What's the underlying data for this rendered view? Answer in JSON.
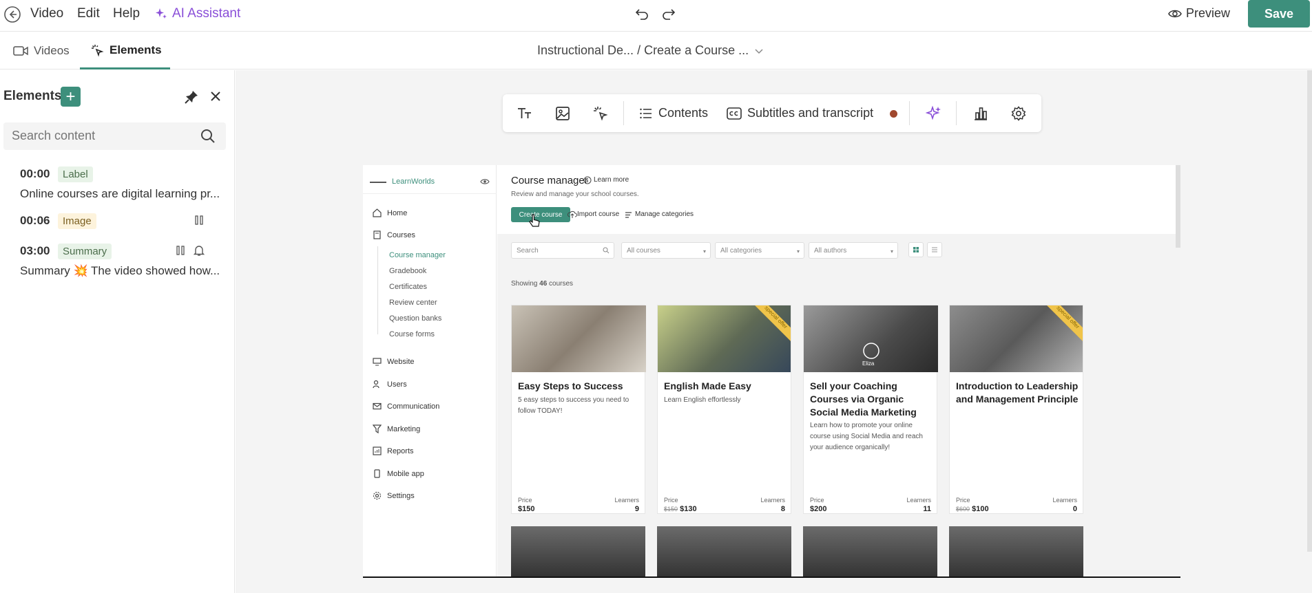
{
  "topbar": {
    "menu": [
      "Video",
      "Edit",
      "Help"
    ],
    "ai_assistant": "AI Assistant",
    "preview": "Preview",
    "save": "Save"
  },
  "tabs": [
    "Videos",
    "Elements"
  ],
  "breadcrumb": "Instructional De...  / Create a Course ...",
  "panel": {
    "title": "Elements",
    "search_placeholder": "Search content",
    "elements": [
      {
        "time": "00:00",
        "type": "Label",
        "text": "Online courses are digital learning pr..."
      },
      {
        "time": "00:06",
        "type": "Image",
        "text": ""
      },
      {
        "time": "03:00",
        "type": "Summary",
        "text": "Summary 💥 The video showed how..."
      }
    ]
  },
  "toolbar": {
    "contents": "Contents",
    "subtitles": "Subtitles and transcript",
    "status_color": "#a0482e"
  },
  "video": {
    "brand": "LearnWorlds",
    "nav": [
      "Home",
      "Courses",
      "Website",
      "Users",
      "Communication",
      "Marketing",
      "Reports",
      "Mobile app",
      "Settings"
    ],
    "courses_sub": [
      "Course manager",
      "Gradebook",
      "Certificates",
      "Review center",
      "Question banks",
      "Course forms"
    ],
    "header_title": "Course manager",
    "learn_more": "Learn more",
    "header_sub": "Review and manage your school courses.",
    "create_course": "Create course",
    "import_course": "Import course",
    "manage_categories": "Manage categories",
    "filters": {
      "search": "Search",
      "all_courses": "All courses",
      "all_categories": "All categories",
      "all_authors": "All authors"
    },
    "showing": "Showing",
    "count": "46",
    "courses_word": "courses",
    "price_label": "Price",
    "learners_label": "Learners",
    "special_offer": "special offer",
    "cards": [
      {
        "title": "Easy Steps to Success",
        "desc": "5 easy steps to success you need to follow TODAY!",
        "old_price": "",
        "price": "$150",
        "learners": "9"
      },
      {
        "title": "English Made Easy",
        "desc": "Learn English effortlessly",
        "old_price": "$150",
        "price": "$130",
        "learners": "8"
      },
      {
        "title": "Sell your Coaching Courses via Organic Social Media Marketing",
        "desc": "Learn how to promote your online course using Social Media and reach your audience organically!",
        "old_price": "",
        "price": "$200",
        "learners": "11"
      },
      {
        "title": "Introduction to Leadership and Management Principle",
        "desc": "",
        "old_price": "$600",
        "price": "$100",
        "learners": "0"
      }
    ],
    "thumb_caption": "Eliza"
  },
  "colors": {
    "accent": "#3d8f7c",
    "ai": "#8a4fd8"
  }
}
